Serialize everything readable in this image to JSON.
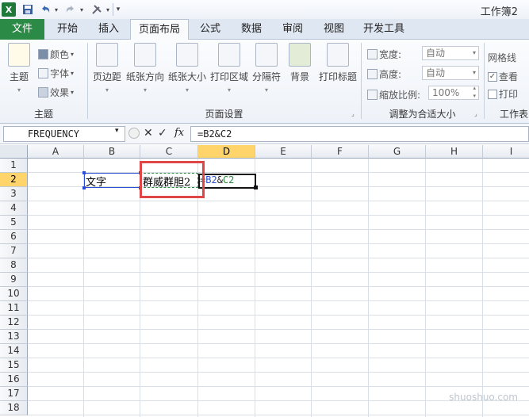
{
  "window": {
    "title": "工作簿2"
  },
  "quick_access": {
    "logo": "X",
    "save_icon": "save-icon",
    "undo_icon": "undo-icon",
    "redo_icon": "redo-icon",
    "customize_icon": "customize-icon"
  },
  "tabs": [
    {
      "label": "文件"
    },
    {
      "label": "开始"
    },
    {
      "label": "插入"
    },
    {
      "label": "页面布局"
    },
    {
      "label": "公式"
    },
    {
      "label": "数据"
    },
    {
      "label": "审阅"
    },
    {
      "label": "视图"
    },
    {
      "label": "开发工具"
    }
  ],
  "ribbon": {
    "theme_group": {
      "label": "主题",
      "theme_button": "主题",
      "colors": "颜色",
      "fonts": "字体",
      "effects": "效果"
    },
    "page_setup_group": {
      "label": "页面设置",
      "buttons": [
        "页边距",
        "纸张方向",
        "纸张大小",
        "打印区域",
        "分隔符",
        "背景",
        "打印标题"
      ]
    },
    "scale_group": {
      "label": "调整为合适大小",
      "width_label": "宽度:",
      "width_value": "自动",
      "height_label": "高度:",
      "height_value": "自动",
      "scale_label": "缩放比例:",
      "scale_value": "100%"
    },
    "sheet_options_group": {
      "label": "工作表",
      "gridlines": "网格线",
      "view": "查看",
      "view_checked": true,
      "print": "打印",
      "print_checked": false
    }
  },
  "formula_bar": {
    "name_box": "FREQUENCY",
    "cancel": "✕",
    "enter": "✓",
    "fx": "fx",
    "formula": "=B2&C2"
  },
  "sheet": {
    "columns": [
      "A",
      "B",
      "C",
      "D",
      "E",
      "F",
      "G",
      "H",
      "I"
    ],
    "rows": [
      "1",
      "2",
      "3",
      "4",
      "5",
      "6",
      "7",
      "8",
      "9",
      "10",
      "11",
      "12",
      "13",
      "14",
      "15",
      "16",
      "17",
      "18"
    ],
    "cells": {
      "B2": "文字",
      "C2": "群威群胆2",
      "D2_ref1": "B2",
      "D2_amp": "&",
      "D2_ref2": "C2",
      "D2_eq": "="
    }
  },
  "watermark": "shuoshuo.com"
}
